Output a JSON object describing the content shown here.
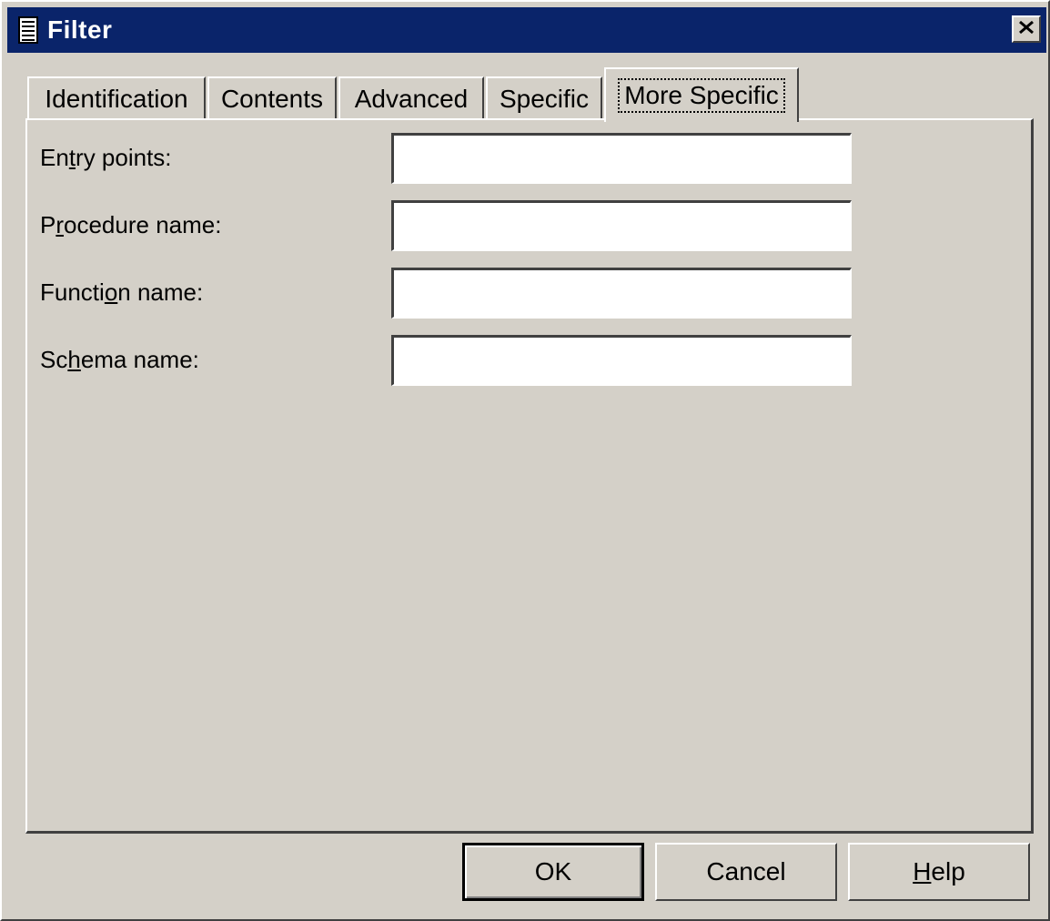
{
  "window": {
    "title": "Filter"
  },
  "tabs": [
    {
      "label": "Identification",
      "active": false
    },
    {
      "label": "Contents",
      "active": false
    },
    {
      "label": "Advanced",
      "active": false
    },
    {
      "label": "Specific",
      "active": false
    },
    {
      "label": "More Specific",
      "active": true
    }
  ],
  "fields": [
    {
      "label_pre": "En",
      "label_key": "t",
      "label_post": "ry points:",
      "value": ""
    },
    {
      "label_pre": "P",
      "label_key": "r",
      "label_post": "ocedure name:",
      "value": ""
    },
    {
      "label_pre": "Functi",
      "label_key": "o",
      "label_post": "n name:",
      "value": ""
    },
    {
      "label_pre": "Sc",
      "label_key": "h",
      "label_post": "ema name:",
      "value": ""
    }
  ],
  "buttons": {
    "ok": "OK",
    "cancel": "Cancel",
    "help_key": "H",
    "help_rest": "elp"
  },
  "icons": {
    "title": "document-icon",
    "close": "close-icon"
  },
  "colors": {
    "titlebar": "#0a246a",
    "face": "#d4d0c8"
  }
}
